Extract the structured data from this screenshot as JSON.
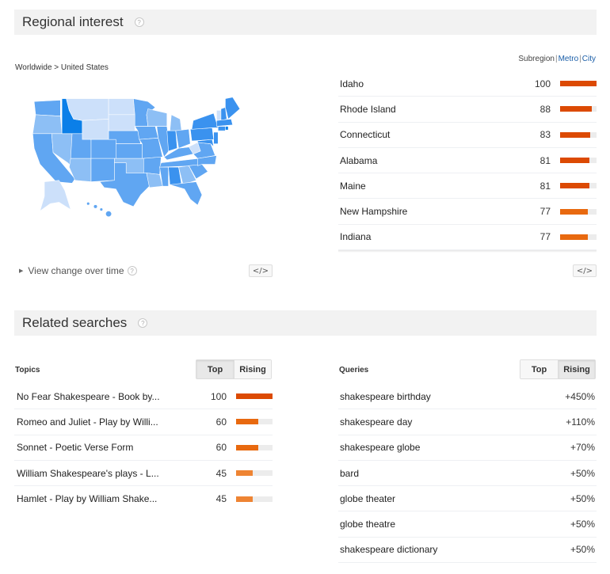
{
  "regional": {
    "title": "Regional interest",
    "help": "?",
    "breadcrumb": "Worldwide > United States",
    "resolution": {
      "subregion": "Subregion",
      "metro": "Metro",
      "city": "City",
      "separator": "|"
    },
    "regions": [
      {
        "name": "Idaho",
        "value": 100,
        "color": "#dc4a03"
      },
      {
        "name": "Rhode Island",
        "value": 88,
        "color": "#dc4a03"
      },
      {
        "name": "Connecticut",
        "value": 83,
        "color": "#dc4a03"
      },
      {
        "name": "Alabama",
        "value": 81,
        "color": "#dc4a03"
      },
      {
        "name": "Maine",
        "value": 81,
        "color": "#dc4a03"
      },
      {
        "name": "New Hampshire",
        "value": 77,
        "color": "#e8690f"
      },
      {
        "name": "Indiana",
        "value": 77,
        "color": "#e8690f"
      }
    ],
    "view_change": "View change over time",
    "embed_label": "</>",
    "map": {
      "colors": {
        "max": "#0b7fe8",
        "high": "#3a92ef",
        "mid": "#60a6f2",
        "low": "#8dbff5",
        "min": "#cce0fa"
      }
    }
  },
  "related": {
    "title": "Related searches",
    "help": "?",
    "topics": {
      "label": "Topics",
      "toggle": {
        "top": "Top",
        "rising": "Rising",
        "active": "top"
      },
      "items": [
        {
          "name": "No Fear Shakespeare - Book by...",
          "value": 100,
          "color": "#dc4a03"
        },
        {
          "name": "Romeo and Juliet - Play by Willi...",
          "value": 60,
          "color": "#e8690f"
        },
        {
          "name": "Sonnet - Poetic Verse Form",
          "value": 60,
          "color": "#e8690f"
        },
        {
          "name": "William Shakespeare's plays - L...",
          "value": 45,
          "color": "#ee8433"
        },
        {
          "name": "Hamlet - Play by William Shake...",
          "value": 45,
          "color": "#ee8433"
        }
      ]
    },
    "queries": {
      "label": "Queries",
      "toggle": {
        "top": "Top",
        "rising": "Rising",
        "active": "rising"
      },
      "items": [
        {
          "name": "shakespeare birthday",
          "value": "+450%"
        },
        {
          "name": "shakespeare day",
          "value": "+110%"
        },
        {
          "name": "shakespeare globe",
          "value": "+70%"
        },
        {
          "name": "bard",
          "value": "+50%"
        },
        {
          "name": "globe theater",
          "value": "+50%"
        },
        {
          "name": "globe theatre",
          "value": "+50%"
        },
        {
          "name": "shakespeare dictionary",
          "value": "+50%"
        }
      ]
    }
  }
}
